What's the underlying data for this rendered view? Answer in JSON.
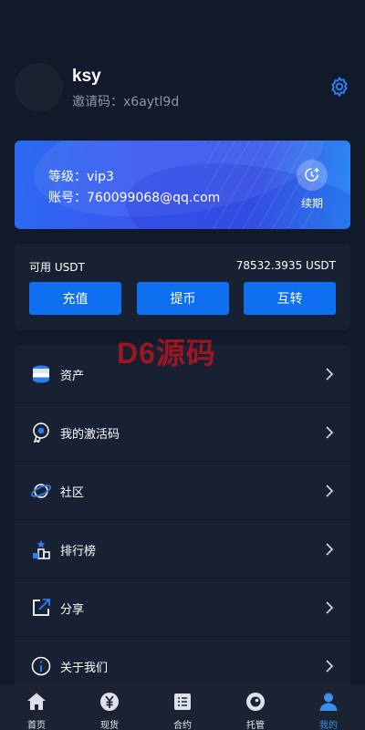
{
  "profile": {
    "username": "ksy",
    "invite_code": "邀请码：x6aytl9d",
    "avatar_icon": "avatar",
    "settings_icon": "gear-icon"
  },
  "vip": {
    "level": "等级：vip3",
    "account": "账号：760099068@qq.com",
    "renew_label": "续期",
    "renew_icon": "clock-plus-icon"
  },
  "balance": {
    "label": "可用 USDT",
    "value": "78532.3935 USDT",
    "buttons": {
      "recharge": "充值",
      "withdraw": "提币",
      "transfer": "互转"
    }
  },
  "watermark": "D6源码",
  "menu": {
    "items": [
      {
        "label": "资产",
        "icon": "coins-icon"
      },
      {
        "label": "我的激活码",
        "icon": "disc-icon"
      },
      {
        "label": "社区",
        "icon": "planet-icon"
      },
      {
        "label": "排行榜",
        "icon": "podium-icon"
      },
      {
        "label": "分享",
        "icon": "share-icon"
      },
      {
        "label": "关于我们",
        "icon": "info-icon"
      }
    ]
  },
  "tabbar": {
    "items": [
      {
        "label": "首页",
        "icon": "home-icon"
      },
      {
        "label": "现货",
        "icon": "yen-icon"
      },
      {
        "label": "合约",
        "icon": "list-icon"
      },
      {
        "label": "托管",
        "icon": "camera-lens-icon"
      },
      {
        "label": "我的",
        "icon": "user-icon"
      }
    ],
    "active_index": 4
  },
  "colors": {
    "background": "#111a2a",
    "panel": "#182133",
    "accent": "#0e6ff0",
    "active_tab": "#3a8ff5"
  }
}
